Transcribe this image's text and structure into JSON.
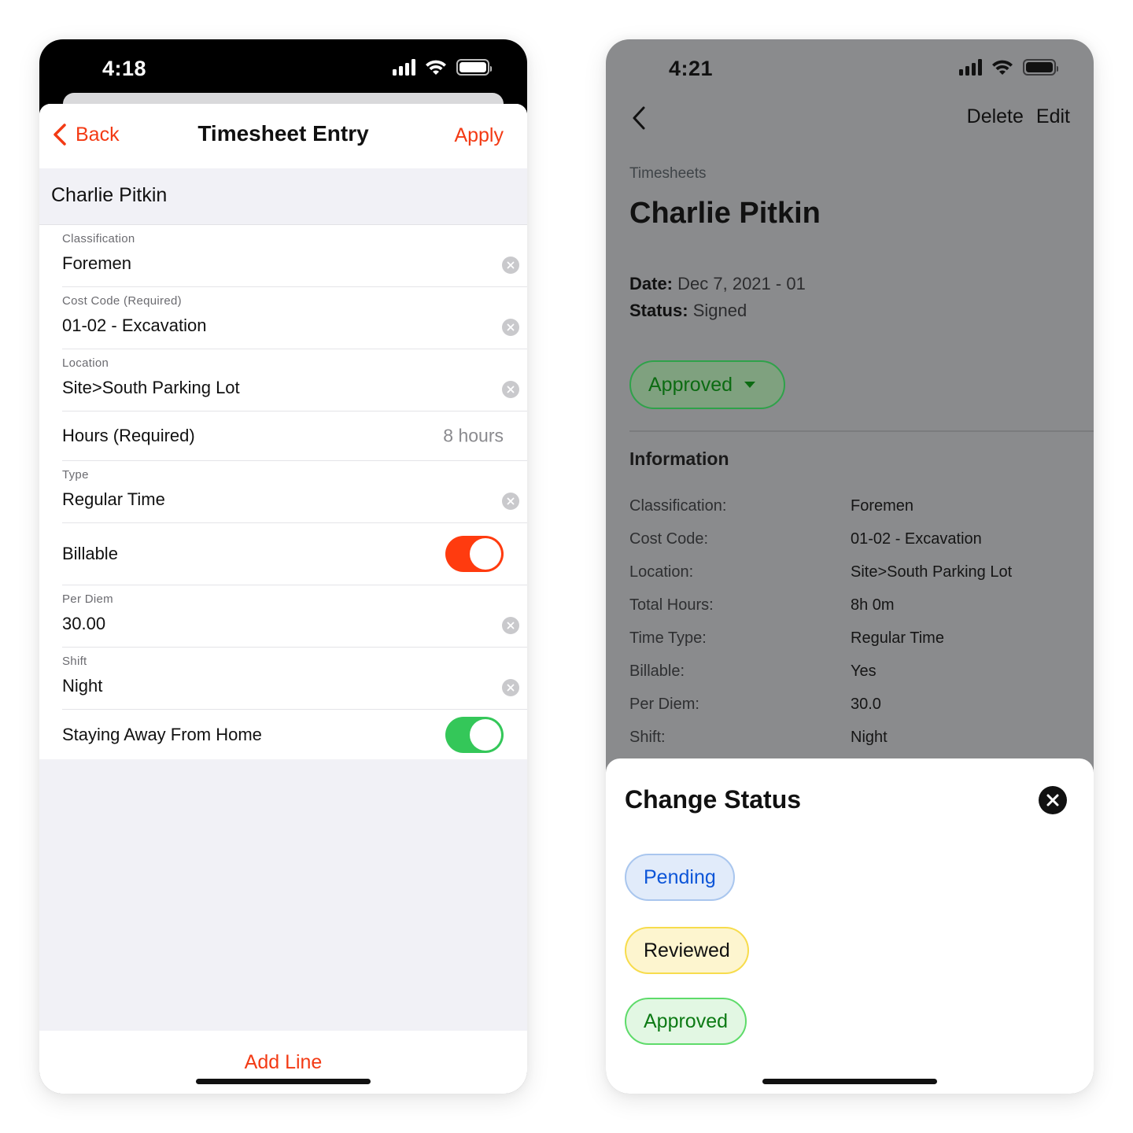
{
  "left_phone": {
    "status_bar": {
      "time": "4:18"
    },
    "nav": {
      "back_label": "Back",
      "title": "Timesheet Entry",
      "apply_label": "Apply"
    },
    "section_header": "Charlie Pitkin",
    "fields": {
      "classification": {
        "label": "Classification",
        "value": "Foremen"
      },
      "cost_code": {
        "label": "Cost Code (Required)",
        "value": "01-02 - Excavation"
      },
      "location": {
        "label": "Location",
        "value": "Site>South Parking Lot"
      },
      "hours": {
        "label": "Hours (Required)",
        "value": "8 hours"
      },
      "type": {
        "label": "Type",
        "value": "Regular Time"
      },
      "billable": {
        "label": "Billable",
        "on": true,
        "color": "#ff3b0f"
      },
      "per_diem": {
        "label": "Per Diem",
        "value": "30.00"
      },
      "shift": {
        "label": "Shift",
        "value": "Night"
      },
      "away_from_home": {
        "label": "Staying Away From Home",
        "on": true,
        "color": "#34c759"
      }
    },
    "footer": {
      "add_line_label": "Add Line"
    }
  },
  "right_phone": {
    "status_bar": {
      "time": "4:21"
    },
    "nav": {
      "delete_label": "Delete",
      "edit_label": "Edit"
    },
    "breadcrumb": "Timesheets",
    "title": "Charlie Pitkin",
    "meta": {
      "date_label": "Date:",
      "date_value": "Dec 7, 2021 - 01",
      "status_label": "Status:",
      "status_value": "Signed"
    },
    "status_dropdown": {
      "label": "Approved"
    },
    "information": {
      "title": "Information",
      "rows": [
        {
          "key": "Classification:",
          "value": "Foremen"
        },
        {
          "key": "Cost Code:",
          "value": "01-02 - Excavation"
        },
        {
          "key": "Location:",
          "value": "Site>South Parking Lot"
        },
        {
          "key": "Total Hours:",
          "value": "8h 0m"
        },
        {
          "key": "Time Type:",
          "value": "Regular Time"
        },
        {
          "key": "Billable:",
          "value": "Yes"
        },
        {
          "key": "Per Diem:",
          "value": "30.0"
        },
        {
          "key": "Shift:",
          "value": "Night"
        }
      ]
    },
    "change_status_modal": {
      "title": "Change Status",
      "options": [
        {
          "label": "Pending",
          "color": "#0c55d8"
        },
        {
          "label": "Reviewed",
          "color": "#111111"
        },
        {
          "label": "Approved",
          "color": "#0c7a14"
        }
      ]
    }
  },
  "colors": {
    "accent": "#f33a14",
    "toggle_on_red": "#ff3b0f",
    "toggle_on_green": "#34c759"
  }
}
